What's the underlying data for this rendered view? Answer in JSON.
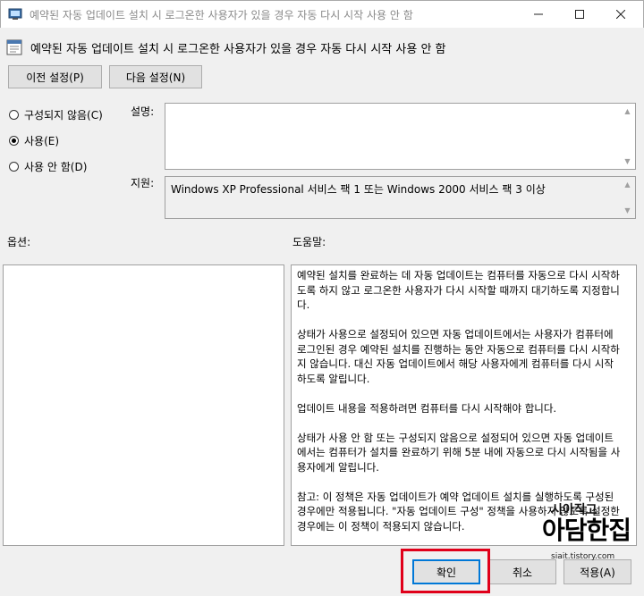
{
  "window": {
    "title": "예약된 자동 업데이트 설치 시 로그온한 사용자가 있을 경우 자동 다시 시작 사용 안 함",
    "controls": {
      "minimize": "—",
      "maximize": "☐",
      "close": "✕"
    }
  },
  "header": {
    "icon": "policy-setting-icon",
    "title": "예약된 자동 업데이트 설치 시 로그온한 사용자가 있을 경우 자동 다시 시작 사용 안 함"
  },
  "nav": {
    "prev_label": "이전 설정(P)",
    "next_label": "다음 설정(N)"
  },
  "radio": {
    "not_configured": "구성되지 않음(C)",
    "enabled": "사용(E)",
    "disabled": "사용 안 함(D)",
    "selected": "enabled"
  },
  "labels": {
    "description": "설명:",
    "supported": "지원:",
    "options": "옵션:",
    "help": "도움말:"
  },
  "supported_on": "Windows XP Professional 서비스 팩 1 또는 Windows 2000 서비스 팩 3 이상",
  "help_paragraphs": [
    "예약된 설치를 완료하는 데 자동 업데이트는 컴퓨터를 자동으로 다시 시작하도록 하지 않고 로그온한 사용자가 다시 시작할 때까지 대기하도록 지정합니다.",
    "상태가 사용으로 설정되어 있으면 자동 업데이트에서는 사용자가 컴퓨터에 로그인된 경우 예약된 설치를 진행하는 동안 자동으로 컴퓨터를 다시 시작하지 않습니다. 대신 자동 업데이트에서 해당 사용자에게 컴퓨터를 다시 시작하도록 알립니다.",
    "업데이트 내용을 적용하려면 컴퓨터를 다시 시작해야 합니다.",
    "상태가 사용 안 함 또는 구성되지 않음으로 설정되어 있으면 자동 업데이트에서는 컴퓨터가 설치를 완료하기 위해 5분 내에 자동으로 다시 시작됨을 사용자에게 알립니다.",
    "참고: 이 정책은 자동 업데이트가 예약 업데이트 설치를 실행하도록 구성된 경우에만 적용됩니다. \"자동 업데이트 구성\" 정책을 사용하지 않도록 설정한 경우에는 이 정책이 적용되지 않습니다."
  ],
  "footer": {
    "ok_label": "확인",
    "cancel_label": "취소",
    "apply_label": "적용(A)"
  },
  "highlight_color": "#e0001a",
  "watermark": {
    "line1": "시아직고",
    "line2": "아담한집",
    "url": "siait.tistory.com"
  }
}
